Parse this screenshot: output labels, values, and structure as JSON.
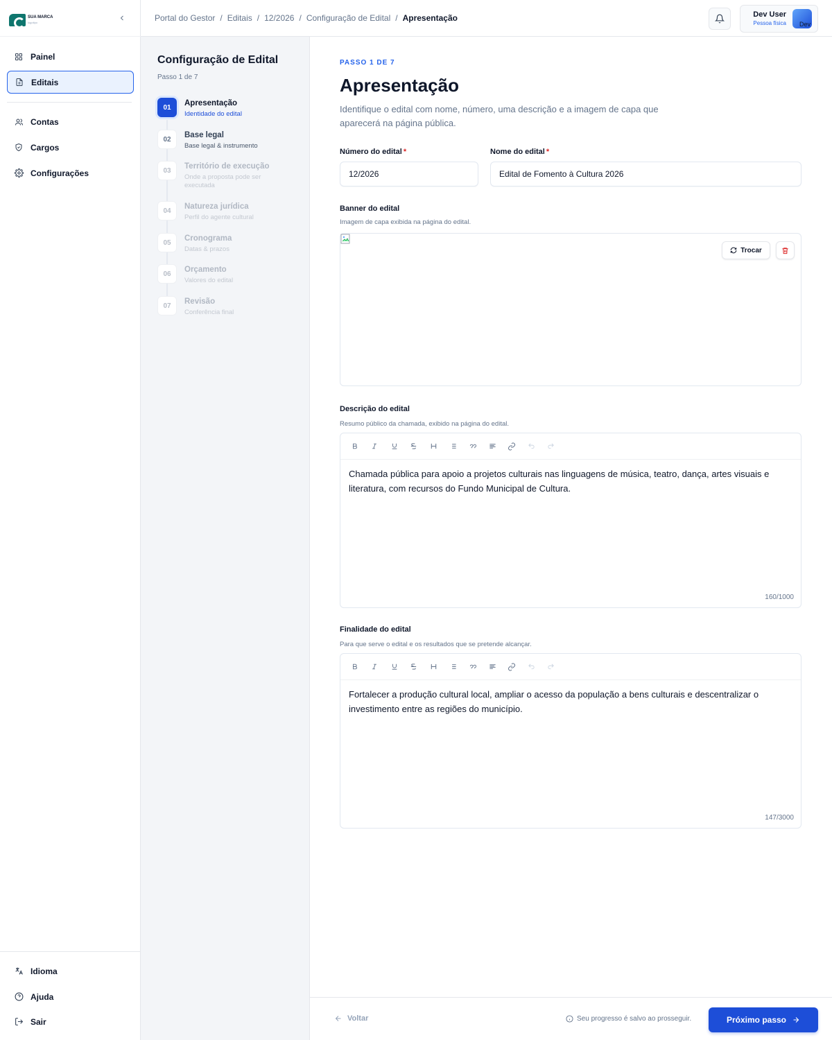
{
  "brand": {
    "name": "SUA MARCA",
    "tagline": "logotipo"
  },
  "sidebar": {
    "items": [
      {
        "label": "Painel"
      },
      {
        "label": "Editais"
      },
      {
        "label": "Contas"
      },
      {
        "label": "Cargos"
      },
      {
        "label": "Configurações"
      }
    ],
    "bottom_items": [
      {
        "label": "Idioma"
      },
      {
        "label": "Ajuda"
      },
      {
        "label": "Sair"
      }
    ]
  },
  "breadcrumb": {
    "items": [
      "Portal do Gestor",
      "Editais",
      "12/2026",
      "Configuração de Edital"
    ],
    "current": "Apresentação",
    "separator": "/"
  },
  "user": {
    "name": "Dev User",
    "type": "Pessoa física",
    "avatar_alt": "Dev"
  },
  "steps_panel": {
    "title": "Configuração de Edital",
    "subtitle": "Passo 1 de 7",
    "steps": [
      {
        "num": "01",
        "title": "Apresentação",
        "desc": "Identidade do edital"
      },
      {
        "num": "02",
        "title": "Base legal",
        "desc": "Base legal & instrumento"
      },
      {
        "num": "03",
        "title": "Território de execução",
        "desc": "Onde a proposta pode ser executada"
      },
      {
        "num": "04",
        "title": "Natureza jurídica",
        "desc": "Perfil do agente cultural"
      },
      {
        "num": "05",
        "title": "Cronograma",
        "desc": "Datas & prazos"
      },
      {
        "num": "06",
        "title": "Orçamento",
        "desc": "Valores do edital"
      },
      {
        "num": "07",
        "title": "Revisão",
        "desc": "Conferência final"
      }
    ]
  },
  "main": {
    "eyebrow": "PASSO 1 DE 7",
    "title": "Apresentação",
    "description": "Identifique o edital com nome, número, uma descrição e a imagem de capa que aparecerá na página pública.",
    "numero": {
      "label": "Número do edital",
      "required": "*",
      "value": "12/2026"
    },
    "nome": {
      "label": "Nome do edital",
      "required": "*",
      "value": "Edital de Fomento à Cultura 2026"
    },
    "banner": {
      "label": "Banner do edital",
      "hint": "Imagem de capa exibida na página do edital.",
      "swap_label": "Trocar"
    },
    "descricao": {
      "label": "Descrição do edital",
      "hint": "Resumo público da chamada, exibido na página do edital.",
      "content": "Chamada pública para apoio a projetos culturais nas linguagens de música, teatro, dança, artes visuais e literatura, com recursos do Fundo Municipal de Cultura.",
      "counter": "160/1000"
    },
    "finalidade": {
      "label": "Finalidade do edital",
      "hint": "Para que serve o edital e os resultados que se pretende alcançar.",
      "content": "Fortalecer a produção cultural local, ampliar o acesso da população a bens culturais e descentralizar o investimento entre as regiões do município.",
      "counter": "147/3000"
    },
    "toolbar_icons": [
      "bold-icon",
      "italic-icon",
      "underline-icon",
      "strikethrough-icon",
      "heading-icon",
      "bullet-list-icon",
      "quote-icon",
      "align-icon",
      "link-icon",
      "undo-icon",
      "redo-icon"
    ]
  },
  "footer": {
    "back_label": "Voltar",
    "save_note": "Seu progresso é salvo ao prosseguir.",
    "next_label": "Próximo passo"
  },
  "colors": {
    "primary": "#1d4ed8",
    "accent": "#2563eb",
    "danger": "#dc2626",
    "brand": "#0f766e"
  }
}
